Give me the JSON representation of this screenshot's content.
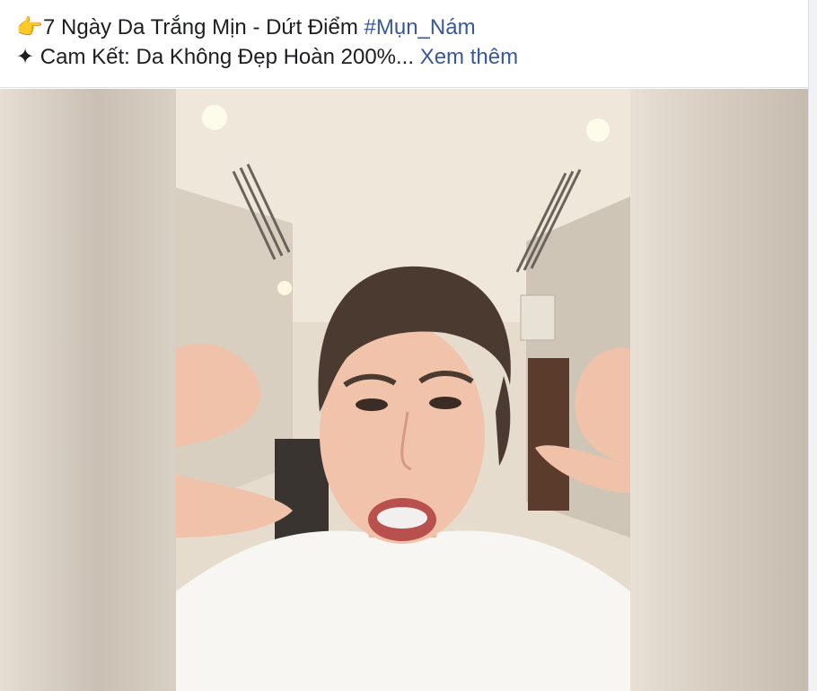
{
  "post": {
    "caption": {
      "line1_emoji": "👉",
      "line1_text": "7 Ngày Da Trắng Mịn - Dứt Điểm ",
      "hashtag": "#Mụn_Nám",
      "line2_symbol": "✦",
      "line2_text": "Cam Kết: Da Không Đẹp Hoàn 200%... ",
      "see_more": "Xem thêm"
    }
  },
  "colors": {
    "link": "#385898",
    "text": "#1c1e21"
  }
}
